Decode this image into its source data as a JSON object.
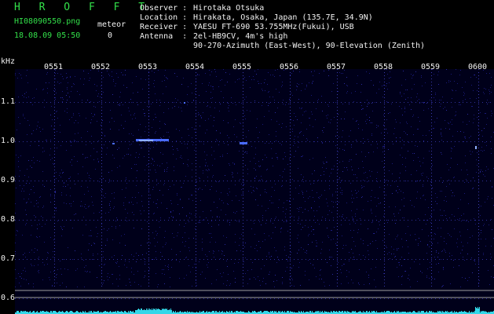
{
  "header": {
    "app_title": "H R O F F T",
    "filename": "HI08090550.png",
    "datetime": "18.08.09 05:50",
    "meteor_label": "meteor",
    "meteor_count": "0"
  },
  "info": {
    "observer_label": "Observer :",
    "observer": "Hirotaka Otsuka",
    "location_label": "Location :",
    "location": "Hirakata, Osaka, Japan (135.7E, 34.9N)",
    "receiver_label": "Receiver :",
    "receiver": "YAESU FT-690 53.755MHz(Fukui), USB",
    "antenna_label": "Antenna  :",
    "antenna": "2el-HB9CV, 4m's high",
    "antenna2": "90-270-Azimuth (East-West), 90-Elevation (Zenith)"
  },
  "spectrogram": {
    "y_unit": "kHz",
    "y_ticks": [
      "1.1",
      "1.0",
      "0.9",
      "0.8",
      "0.7",
      "0.6"
    ],
    "x_ticks": [
      "0551",
      "0552",
      "0553",
      "0554",
      "0555",
      "0556",
      "0557",
      "0558",
      "0559",
      "0600"
    ],
    "colors": {
      "background": "#00001a",
      "noise": "#1a1a7a",
      "signal": "#4a6cff",
      "strong": "#8fb0ff",
      "ref_line": "#b0b0b0",
      "baseline": "#33d7e8"
    }
  }
}
